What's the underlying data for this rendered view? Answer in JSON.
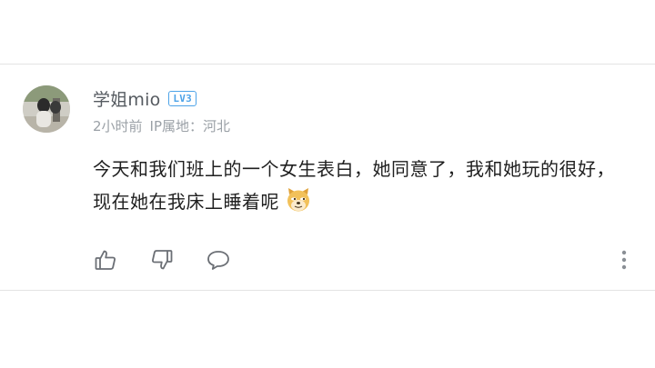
{
  "comment": {
    "username": "学姐mio",
    "level_badge": "LV3",
    "time": "2小时前",
    "location": "IP属地：河北",
    "content": "今天和我们班上的一个女生表白，她同意了，我和她玩的很好，现在她在我床上睡着呢",
    "emoji": "doge-emoji"
  },
  "actions": {
    "like_icon": "thumbs-up-icon",
    "dislike_icon": "thumbs-down-icon",
    "reply_icon": "comment-bubble-icon",
    "more_icon": "more-vertical-icon"
  },
  "colors": {
    "text_primary": "#1f1f1f",
    "text_secondary": "#555a60",
    "meta": "#9aa0a6",
    "badge": "#4da3e8",
    "divider": "#e3e3e3"
  }
}
